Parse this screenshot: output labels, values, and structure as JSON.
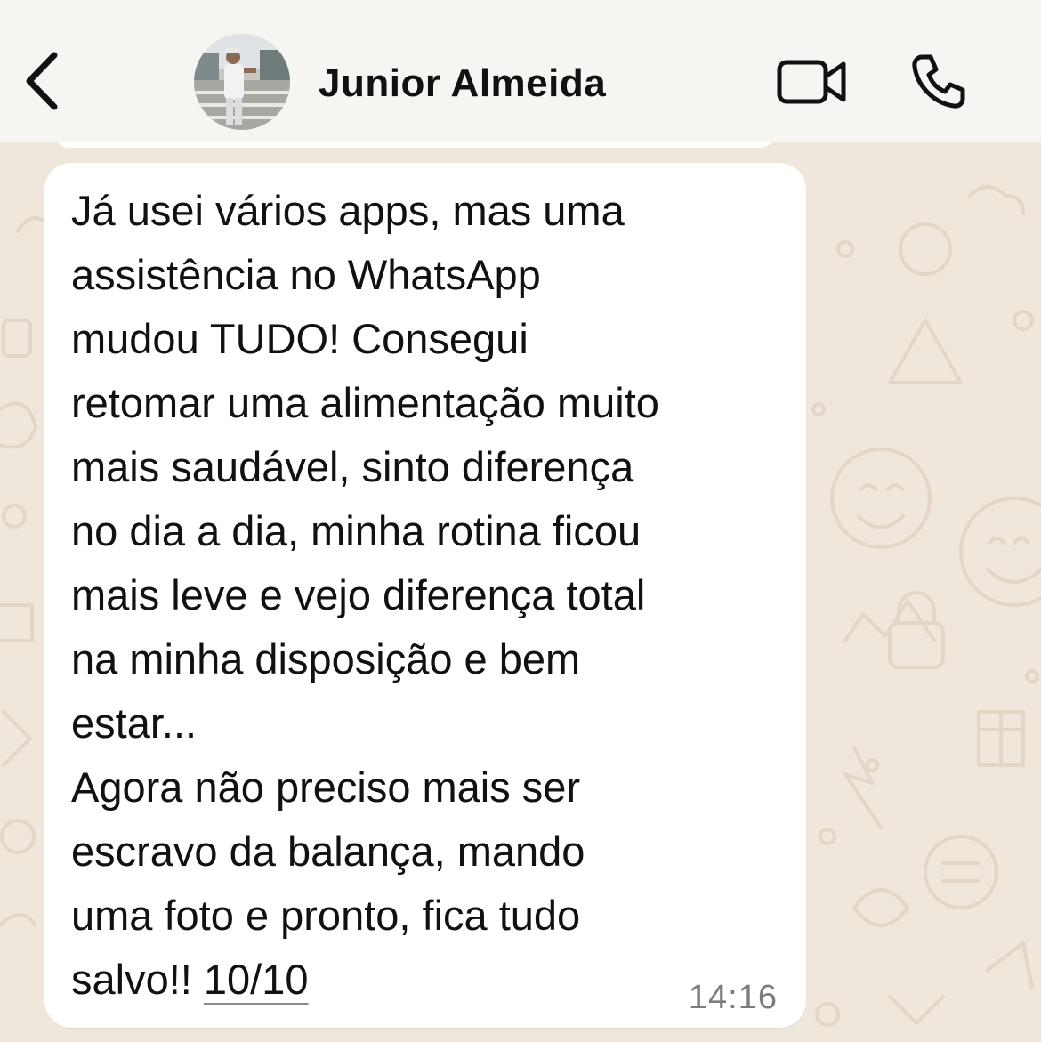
{
  "header": {
    "contact_name": "Junior Almeida",
    "back_icon": "chevron-left-icon",
    "video_icon": "video-camera-icon",
    "call_icon": "phone-icon"
  },
  "message": {
    "lines": [
      "Já usei vários apps, mas uma",
      "assistência no WhatsApp",
      "mudou TUDO! Consegui",
      "retomar uma alimentação muito",
      "mais saudável, sinto diferença",
      "no dia a dia, minha rotina ficou",
      "mais leve e vejo diferença total",
      "na minha disposição e bem",
      "estar...",
      "Agora não preciso mais ser",
      "escravo da balança, mando",
      "uma foto e pronto, fica tudo"
    ],
    "last_line_prefix": "salvo!! ",
    "rating": "10/10",
    "time": "14:16"
  },
  "colors": {
    "bubble": "#ffffff",
    "wallpaper": "#efe7dc",
    "header": "#f6f5f1",
    "text": "#111111",
    "timestamp": "#7c7c7c"
  }
}
